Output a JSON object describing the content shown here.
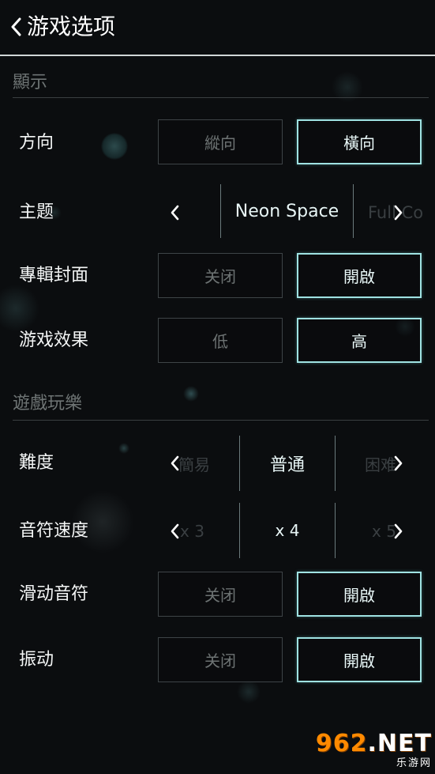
{
  "header": {
    "title": "游戏选项"
  },
  "sections": {
    "display": "顯示",
    "gameplay": "遊戲玩樂"
  },
  "display": {
    "orientation": {
      "label": "方向",
      "options": [
        "縱向",
        "橫向"
      ],
      "selected": "橫向"
    },
    "theme": {
      "label": "主题",
      "value": "Neon Space",
      "next_peek": "Full Co"
    },
    "album_cover": {
      "label": "專輯封面",
      "options": [
        "关闭",
        "開啟"
      ],
      "selected": "開啟"
    },
    "game_effects": {
      "label": "游戏效果",
      "options": [
        "低",
        "高"
      ],
      "selected": "高"
    }
  },
  "gameplay": {
    "difficulty": {
      "label": "難度",
      "prev_peek": "簡易",
      "value": "普通",
      "next_peek": "困难"
    },
    "note_speed": {
      "label": "音符速度",
      "prev_peek": "x 3",
      "value": "x 4",
      "next_peek": "x 5"
    },
    "slide_notes": {
      "label": "滑动音符",
      "options": [
        "关闭",
        "開啟"
      ],
      "selected": "開啟"
    },
    "vibration": {
      "label": "振动",
      "options": [
        "关闭",
        "開啟"
      ],
      "selected": "開啟"
    }
  },
  "watermark": {
    "main_a": "962",
    "main_b": ".NET",
    "sub": "乐游网"
  },
  "icons": {
    "back": "chevron-left-icon",
    "prev": "chevron-left-icon",
    "next": "chevron-right-icon"
  },
  "colors": {
    "accent": "#9fe2e2",
    "background": "#0b0d0f",
    "inactive_text": "#6d7373"
  }
}
